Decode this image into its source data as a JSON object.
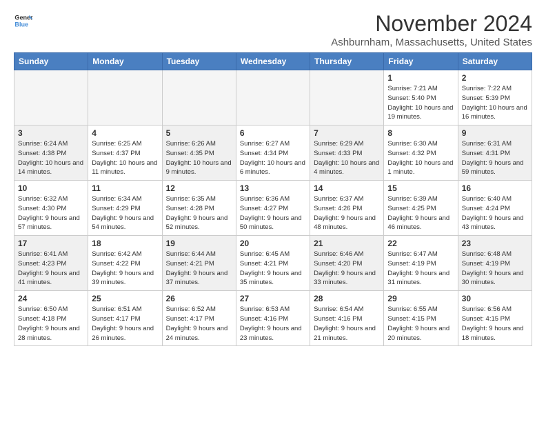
{
  "header": {
    "logo_general": "General",
    "logo_blue": "Blue",
    "month_year": "November 2024",
    "location": "Ashburnham, Massachusetts, United States"
  },
  "weekdays": [
    "Sunday",
    "Monday",
    "Tuesday",
    "Wednesday",
    "Thursday",
    "Friday",
    "Saturday"
  ],
  "weeks": [
    [
      {
        "day": "",
        "info": ""
      },
      {
        "day": "",
        "info": ""
      },
      {
        "day": "",
        "info": ""
      },
      {
        "day": "",
        "info": ""
      },
      {
        "day": "",
        "info": ""
      },
      {
        "day": "1",
        "info": "Sunrise: 7:21 AM\nSunset: 5:40 PM\nDaylight: 10 hours and 19 minutes."
      },
      {
        "day": "2",
        "info": "Sunrise: 7:22 AM\nSunset: 5:39 PM\nDaylight: 10 hours and 16 minutes."
      }
    ],
    [
      {
        "day": "3",
        "info": "Sunrise: 6:24 AM\nSunset: 4:38 PM\nDaylight: 10 hours and 14 minutes."
      },
      {
        "day": "4",
        "info": "Sunrise: 6:25 AM\nSunset: 4:37 PM\nDaylight: 10 hours and 11 minutes."
      },
      {
        "day": "5",
        "info": "Sunrise: 6:26 AM\nSunset: 4:35 PM\nDaylight: 10 hours and 9 minutes."
      },
      {
        "day": "6",
        "info": "Sunrise: 6:27 AM\nSunset: 4:34 PM\nDaylight: 10 hours and 6 minutes."
      },
      {
        "day": "7",
        "info": "Sunrise: 6:29 AM\nSunset: 4:33 PM\nDaylight: 10 hours and 4 minutes."
      },
      {
        "day": "8",
        "info": "Sunrise: 6:30 AM\nSunset: 4:32 PM\nDaylight: 10 hours and 1 minute."
      },
      {
        "day": "9",
        "info": "Sunrise: 6:31 AM\nSunset: 4:31 PM\nDaylight: 9 hours and 59 minutes."
      }
    ],
    [
      {
        "day": "10",
        "info": "Sunrise: 6:32 AM\nSunset: 4:30 PM\nDaylight: 9 hours and 57 minutes."
      },
      {
        "day": "11",
        "info": "Sunrise: 6:34 AM\nSunset: 4:29 PM\nDaylight: 9 hours and 54 minutes."
      },
      {
        "day": "12",
        "info": "Sunrise: 6:35 AM\nSunset: 4:28 PM\nDaylight: 9 hours and 52 minutes."
      },
      {
        "day": "13",
        "info": "Sunrise: 6:36 AM\nSunset: 4:27 PM\nDaylight: 9 hours and 50 minutes."
      },
      {
        "day": "14",
        "info": "Sunrise: 6:37 AM\nSunset: 4:26 PM\nDaylight: 9 hours and 48 minutes."
      },
      {
        "day": "15",
        "info": "Sunrise: 6:39 AM\nSunset: 4:25 PM\nDaylight: 9 hours and 46 minutes."
      },
      {
        "day": "16",
        "info": "Sunrise: 6:40 AM\nSunset: 4:24 PM\nDaylight: 9 hours and 43 minutes."
      }
    ],
    [
      {
        "day": "17",
        "info": "Sunrise: 6:41 AM\nSunset: 4:23 PM\nDaylight: 9 hours and 41 minutes."
      },
      {
        "day": "18",
        "info": "Sunrise: 6:42 AM\nSunset: 4:22 PM\nDaylight: 9 hours and 39 minutes."
      },
      {
        "day": "19",
        "info": "Sunrise: 6:44 AM\nSunset: 4:21 PM\nDaylight: 9 hours and 37 minutes."
      },
      {
        "day": "20",
        "info": "Sunrise: 6:45 AM\nSunset: 4:21 PM\nDaylight: 9 hours and 35 minutes."
      },
      {
        "day": "21",
        "info": "Sunrise: 6:46 AM\nSunset: 4:20 PM\nDaylight: 9 hours and 33 minutes."
      },
      {
        "day": "22",
        "info": "Sunrise: 6:47 AM\nSunset: 4:19 PM\nDaylight: 9 hours and 31 minutes."
      },
      {
        "day": "23",
        "info": "Sunrise: 6:48 AM\nSunset: 4:19 PM\nDaylight: 9 hours and 30 minutes."
      }
    ],
    [
      {
        "day": "24",
        "info": "Sunrise: 6:50 AM\nSunset: 4:18 PM\nDaylight: 9 hours and 28 minutes."
      },
      {
        "day": "25",
        "info": "Sunrise: 6:51 AM\nSunset: 4:17 PM\nDaylight: 9 hours and 26 minutes."
      },
      {
        "day": "26",
        "info": "Sunrise: 6:52 AM\nSunset: 4:17 PM\nDaylight: 9 hours and 24 minutes."
      },
      {
        "day": "27",
        "info": "Sunrise: 6:53 AM\nSunset: 4:16 PM\nDaylight: 9 hours and 23 minutes."
      },
      {
        "day": "28",
        "info": "Sunrise: 6:54 AM\nSunset: 4:16 PM\nDaylight: 9 hours and 21 minutes."
      },
      {
        "day": "29",
        "info": "Sunrise: 6:55 AM\nSunset: 4:15 PM\nDaylight: 9 hours and 20 minutes."
      },
      {
        "day": "30",
        "info": "Sunrise: 6:56 AM\nSunset: 4:15 PM\nDaylight: 9 hours and 18 minutes."
      }
    ]
  ]
}
